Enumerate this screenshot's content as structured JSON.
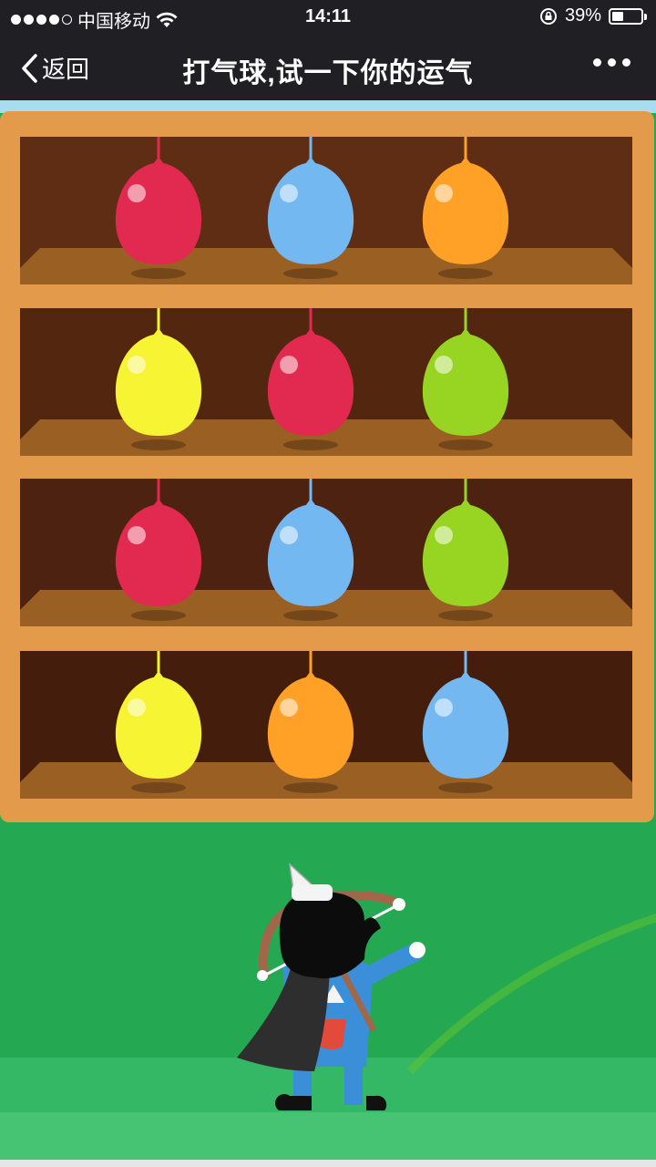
{
  "status_bar": {
    "carrier": "中国移动",
    "time": "14:11",
    "battery": "39%",
    "battery_level": 0.39,
    "signal_bars": 4
  },
  "nav": {
    "back_label": "返回",
    "title": "打气球,试一下你的运气"
  },
  "game": {
    "shelves": [
      {
        "balloons": [
          "red",
          "blue",
          "orange"
        ]
      },
      {
        "balloons": [
          "yellow",
          "red",
          "green"
        ]
      },
      {
        "balloons": [
          "red",
          "blue",
          "green"
        ]
      },
      {
        "balloons": [
          "yellow",
          "orange",
          "blue"
        ]
      }
    ],
    "colors": {
      "red": "#e2294f",
      "blue": "#73b8f0",
      "orange": "#ffa126",
      "yellow": "#f7f433",
      "green": "#97d522",
      "cabinet": "#e39a4b",
      "grass": "#24a851"
    }
  }
}
